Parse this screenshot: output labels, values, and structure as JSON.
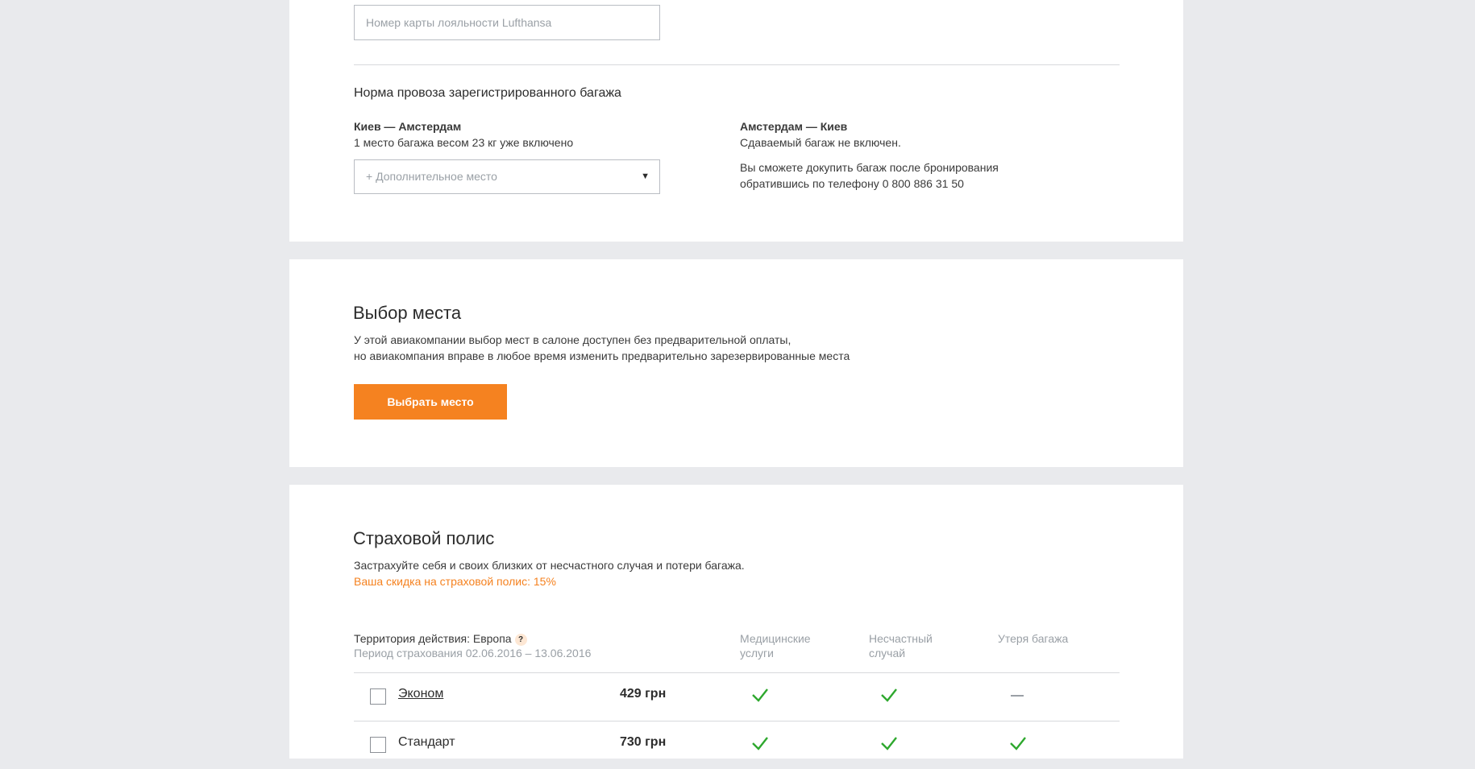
{
  "loyalty": {
    "card_placeholder": "Номер карты лояльности Lufthansa"
  },
  "baggage": {
    "title": "Норма провоза зарегистрированного багажа",
    "outbound": {
      "route": "Киев — Амстердам",
      "info": "1 место багажа весом 23 кг уже включено",
      "select_placeholder": "+ Дополнительное место"
    },
    "inbound": {
      "route": "Амстердам — Киев",
      "info": "Сдаваемый багаж не включен.",
      "note_line1": "Вы сможете докупить багаж после бронирования",
      "note_line2": "обратившись по телефону 0 800 886 31 50"
    }
  },
  "seat": {
    "title": "Выбор места",
    "desc_line1": "У этой авиакомпании выбор мест в салоне доступен без предварительной оплаты,",
    "desc_line2": "но авиакомпания вправе в любое время изменить предварительно зарезервированные места",
    "button_label": "Выбрать место"
  },
  "insurance": {
    "title": "Страховой полис",
    "desc": "Застрахуйте себя и своих близких от несчастного случая и потери багажа.",
    "discount": "Ваша скидка на страховой полис: 15%",
    "territory": "Территория действия: Европа",
    "help_glyph": "?",
    "period": "Период страхования 02.06.2016 – 13.06.2016",
    "columns": {
      "medical_line1": "Медицинские",
      "medical_line2": "услуги",
      "accident_line1": "Несчастный",
      "accident_line2": "случай",
      "baggage": "Утеря багажа"
    },
    "plans": [
      {
        "name": "Эконом",
        "price": "429 грн",
        "medical": true,
        "accident": true,
        "baggage": false
      },
      {
        "name": "Стандарт",
        "price": "730 грн",
        "medical": true,
        "accident": true,
        "baggage": true
      }
    ],
    "colors": {
      "check": "#2ea82e",
      "accent": "#f58220"
    }
  }
}
